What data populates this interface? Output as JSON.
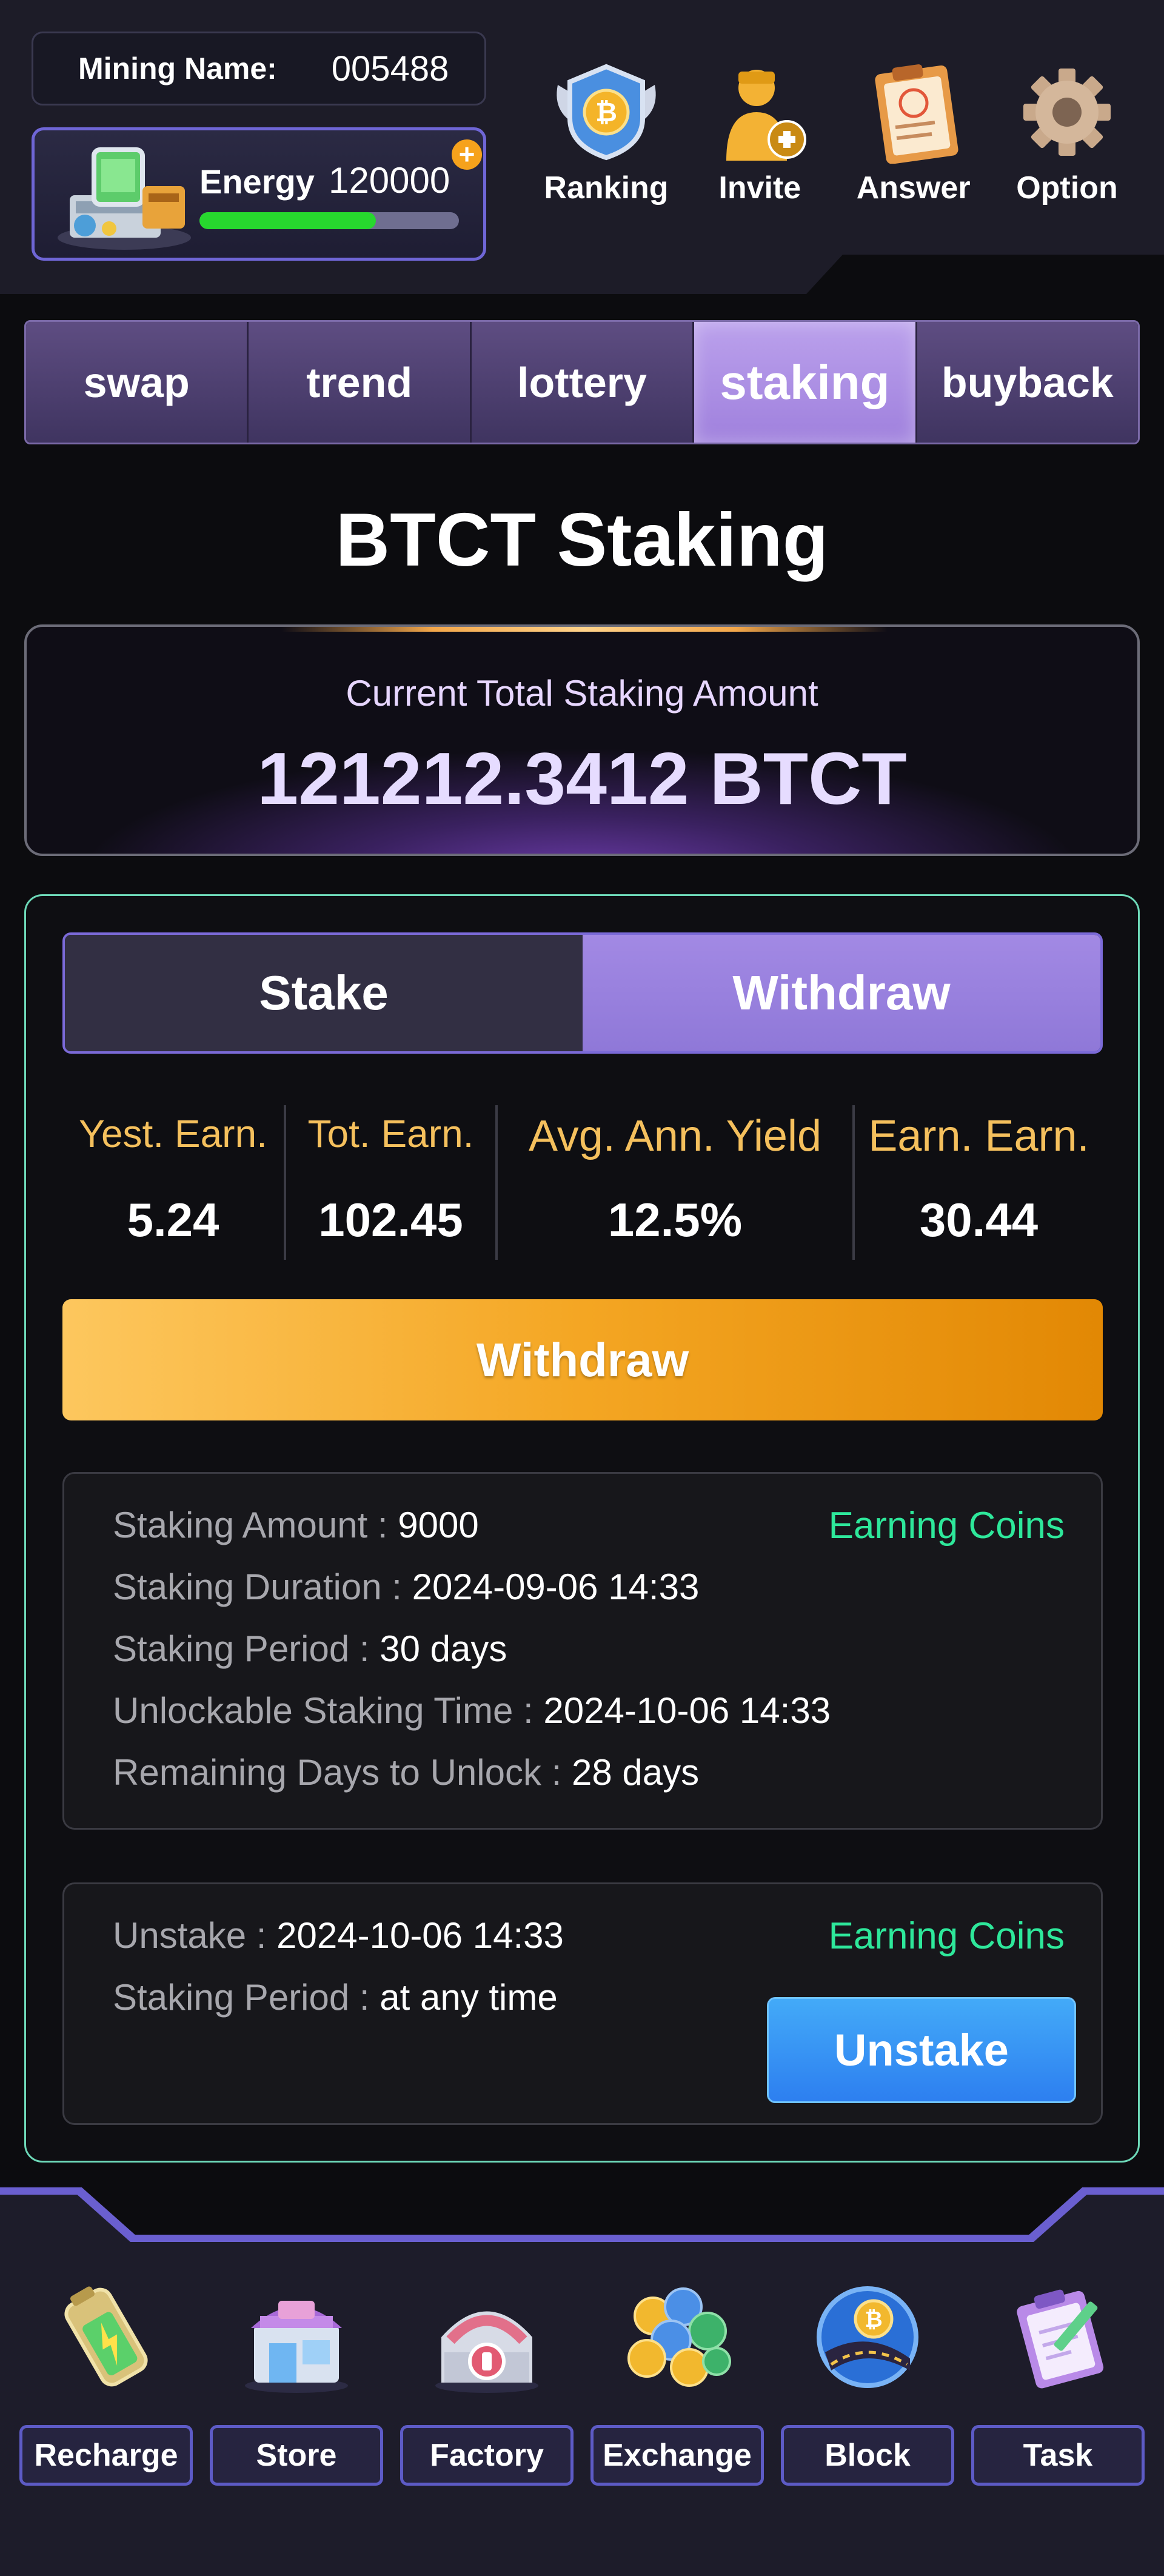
{
  "header": {
    "mining_name_label": "Mining Name:",
    "mining_name_value": "005488",
    "energy_label": "Energy",
    "energy_value": "120000",
    "energy_plus": "+",
    "energy_level": 0.68,
    "nav": [
      {
        "label": "Ranking",
        "icon": "ranking-badge-icon"
      },
      {
        "label": "Invite",
        "icon": "invite-user-icon"
      },
      {
        "label": "Answer",
        "icon": "answer-clipboard-icon"
      },
      {
        "label": "Option",
        "icon": "gear-icon"
      }
    ]
  },
  "tabs": [
    {
      "label": "swap",
      "active": false
    },
    {
      "label": "trend",
      "active": false
    },
    {
      "label": "lottery",
      "active": false
    },
    {
      "label": "staking",
      "active": true
    },
    {
      "label": "buyback",
      "active": false
    }
  ],
  "page_title": "BTCT Staking",
  "total": {
    "label": "Current Total Staking Amount",
    "value": "121212.3412 BTCT"
  },
  "toggle": {
    "stake": "Stake",
    "withdraw": "Withdraw",
    "active": "withdraw"
  },
  "stats": [
    {
      "title": "Yest. Earn.",
      "value": "5.24"
    },
    {
      "title": "Tot. Earn.",
      "value": "102.45"
    },
    {
      "title": "Avg. Ann. Yield",
      "value": "12.5%"
    },
    {
      "title": "Earn. Earn.",
      "value": "30.44"
    }
  ],
  "withdraw_button": "Withdraw",
  "staking_card": {
    "status": "Earning Coins",
    "rows": [
      {
        "key": "Staking Amount",
        "value": "9000"
      },
      {
        "key": "Staking Duration",
        "value": "2024-09-06 14:33"
      },
      {
        "key": "Staking Period",
        "value": "30 days"
      },
      {
        "key": "Unlockable Staking Time",
        "value": "2024-10-06 14:33"
      },
      {
        "key": "Remaining Days to Unlock",
        "value": "28 days"
      }
    ]
  },
  "unstake_card": {
    "status": "Earning Coins",
    "rows": [
      {
        "key": "Unstake",
        "value": "2024-10-06 14:33"
      },
      {
        "key": "Staking Period",
        "value": "at any time"
      }
    ],
    "button": "Unstake"
  },
  "separator": " : ",
  "bottom_nav": [
    {
      "label": "Recharge",
      "icon": "battery-icon"
    },
    {
      "label": "Store",
      "icon": "store-icon"
    },
    {
      "label": "Factory",
      "icon": "factory-icon"
    },
    {
      "label": "Exchange",
      "icon": "coins-icon"
    },
    {
      "label": "Block",
      "icon": "block-globe-icon"
    },
    {
      "label": "Task",
      "icon": "task-clipboard-icon"
    }
  ],
  "colors": {
    "accent_purple": "#9f80dd",
    "earning_green": "#2ee89b",
    "stat_gold": "#f5c05d",
    "withdraw_orange": "#f4a623",
    "unstake_blue": "#2d7ff0",
    "energy_green": "#27d82e"
  }
}
